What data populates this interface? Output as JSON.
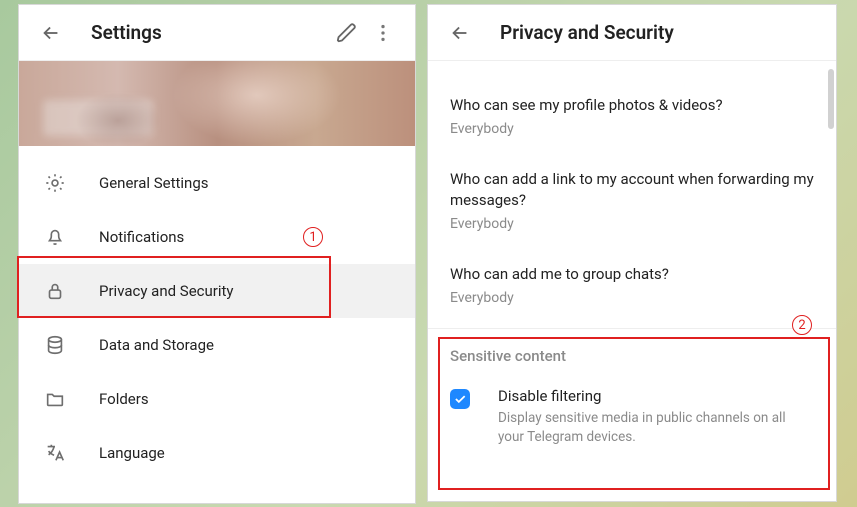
{
  "left": {
    "title": "Settings",
    "items": [
      {
        "icon": "gear",
        "label": "General Settings"
      },
      {
        "icon": "bell",
        "label": "Notifications"
      },
      {
        "icon": "lock",
        "label": "Privacy and Security",
        "selected": true
      },
      {
        "icon": "database",
        "label": "Data and Storage"
      },
      {
        "icon": "folder",
        "label": "Folders"
      },
      {
        "icon": "language",
        "label": "Language"
      }
    ]
  },
  "right": {
    "title": "Privacy and Security",
    "privacy": [
      {
        "q": "Who can see my profile photos & videos?",
        "v": "Everybody"
      },
      {
        "q": "Who can add a link to my account when forwarding my messages?",
        "v": "Everybody"
      },
      {
        "q": "Who can add me to group chats?",
        "v": "Everybody"
      }
    ],
    "section_title": "Sensitive content",
    "disable_filtering": {
      "label": "Disable filtering",
      "desc": "Display sensitive media in public channels on all your Telegram devices.",
      "checked": true
    }
  },
  "callouts": {
    "n1": "1",
    "n2": "2"
  }
}
